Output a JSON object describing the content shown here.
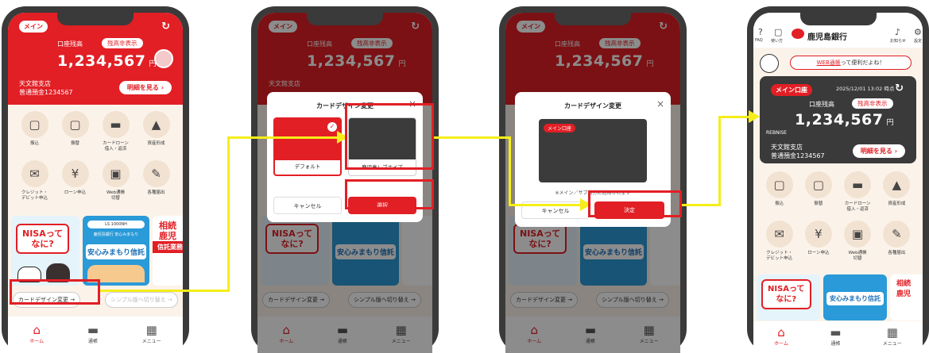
{
  "home": {
    "main_tag": "メイン",
    "balance_label": "口座残高",
    "hide_balance": "残高非表示",
    "balance": "1,234,567",
    "currency": "円",
    "branch": "天文館支店",
    "account": "普通預金1234567",
    "detail_button": "明細を見る ›",
    "menu": [
      {
        "icon": "▢",
        "label": "振込"
      },
      {
        "icon": "▢",
        "label": "振替"
      },
      {
        "icon": "▬",
        "label": "カードローン\n借入・返済"
      },
      {
        "icon": "▲",
        "label": "資産形成"
      },
      {
        "icon": "✉",
        "label": "クレジット・\nデビット申込"
      },
      {
        "icon": "¥",
        "label": "ローン申込"
      },
      {
        "icon": "▣",
        "label": "Web通帳\n切替"
      },
      {
        "icon": "✎",
        "label": "各種届出"
      }
    ],
    "banner_nisa": "NISAって\nなに?",
    "banner_trust_top": "LS 1000NH",
    "banner_trust_sub": "鹿児島銀行 安心みまもり",
    "banner_trust_main": "安心みまもり信託",
    "banner_side_1": "相続\n鹿児",
    "banner_side_2": "信託業務",
    "card_design_button": "カードデザイン変更 →",
    "simple_button": "シンプル版へ切り替え →",
    "tabs": [
      {
        "icon": "⌂",
        "label": "ホーム"
      },
      {
        "icon": "▬",
        "label": "通帳"
      },
      {
        "icon": "▦",
        "label": "メニュー"
      }
    ]
  },
  "modal1": {
    "title": "カードデザイン変更",
    "close": "×",
    "option_default": "デフォルト",
    "option_rebnise": "鹿児島レブナイズ",
    "cancel": "キャンセル",
    "select": "選択"
  },
  "modal2": {
    "title": "カードデザイン変更",
    "close": "×",
    "preview_tag": "メイン口座",
    "note": "※メイン／サブ両方に適用されます",
    "cancel": "キャンセル",
    "decide": "決定"
  },
  "phone4": {
    "faq": "FAQ",
    "howto": "使い方",
    "bank_name": "鹿児島銀行",
    "notice": "お知らせ",
    "settings": "設定",
    "web_banner_link": "WEB通帳",
    "web_banner_rest": "って便利だよね！",
    "main_tag": "メイン口座",
    "date": "2025/12/01 13:02 時点",
    "rebnise": "REBNISE"
  },
  "colors": {
    "brand_red": "#e11f25",
    "arrow_yellow": "#f5ee19",
    "bg_cream": "#fbf3ea"
  }
}
